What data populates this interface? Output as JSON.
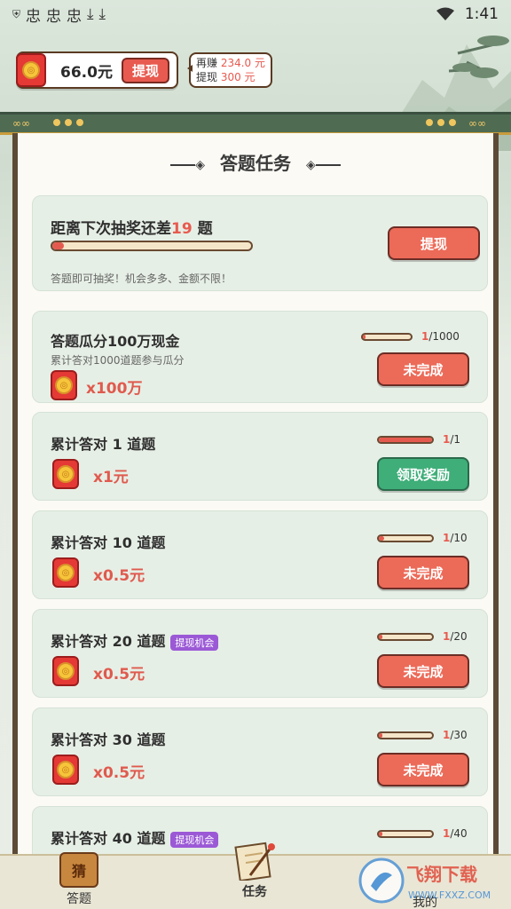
{
  "status": {
    "time": "1:41",
    "notif_glyphs": [
      "忠",
      "忠",
      "忠"
    ]
  },
  "balance": {
    "amount": "66.0元",
    "withdraw_label": "提现",
    "more_label": "再赚",
    "more_value": "234.0 元",
    "withdraw_line_label": "提现",
    "withdraw_line_value": "300 元"
  },
  "panel": {
    "title": "答题任务"
  },
  "lottery": {
    "prefix": "距离下次抽奖还差",
    "count": "19",
    "suffix": "题",
    "button": "提现",
    "note": "答题即可抽奖！机会多多、金额不限！",
    "progress": 0.04
  },
  "tasks": [
    {
      "title": "答题瓜分100万现金",
      "sub": "累计答对1000道题参与瓜分",
      "reward": "x100万",
      "cur": "1",
      "total": "/1000",
      "progress": 0.001,
      "button": "未完成",
      "status": "incomplete",
      "badge": ""
    },
    {
      "title": "累计答对 1 道题",
      "sub": "",
      "reward": "x1元",
      "cur": "1",
      "total": "/1",
      "progress": 1.0,
      "button": "领取奖励",
      "status": "claim",
      "badge": ""
    },
    {
      "title": "累计答对 10 道题",
      "sub": "",
      "reward": "x0.5元",
      "cur": "1",
      "total": "/10",
      "progress": 0.1,
      "button": "未完成",
      "status": "incomplete",
      "badge": ""
    },
    {
      "title": "累计答对 20 道题",
      "sub": "",
      "reward": "x0.5元",
      "cur": "1",
      "total": "/20",
      "progress": 0.05,
      "button": "未完成",
      "status": "incomplete",
      "badge": "提现机会"
    },
    {
      "title": "累计答对 30 道题",
      "sub": "",
      "reward": "x0.5元",
      "cur": "1",
      "total": "/30",
      "progress": 0.033,
      "button": "未完成",
      "status": "incomplete",
      "badge": ""
    },
    {
      "title": "累计答对 40 道题",
      "sub": "",
      "reward": "",
      "cur": "1",
      "total": "/40",
      "progress": 0.025,
      "button": "",
      "status": "incomplete",
      "badge": "提现机会"
    }
  ],
  "nav": {
    "items": [
      {
        "label": "答题",
        "icon_text": "猜",
        "active": false
      },
      {
        "label": "任务",
        "active": true
      },
      {
        "label": "我的",
        "active": false
      }
    ]
  },
  "watermark": {
    "text": "飞翔下载",
    "sub": "WWW.FXXZ.COM"
  },
  "colors": {
    "accent": "#e85a4f",
    "green": "#3fae79",
    "panel": "#fbfaf5"
  }
}
